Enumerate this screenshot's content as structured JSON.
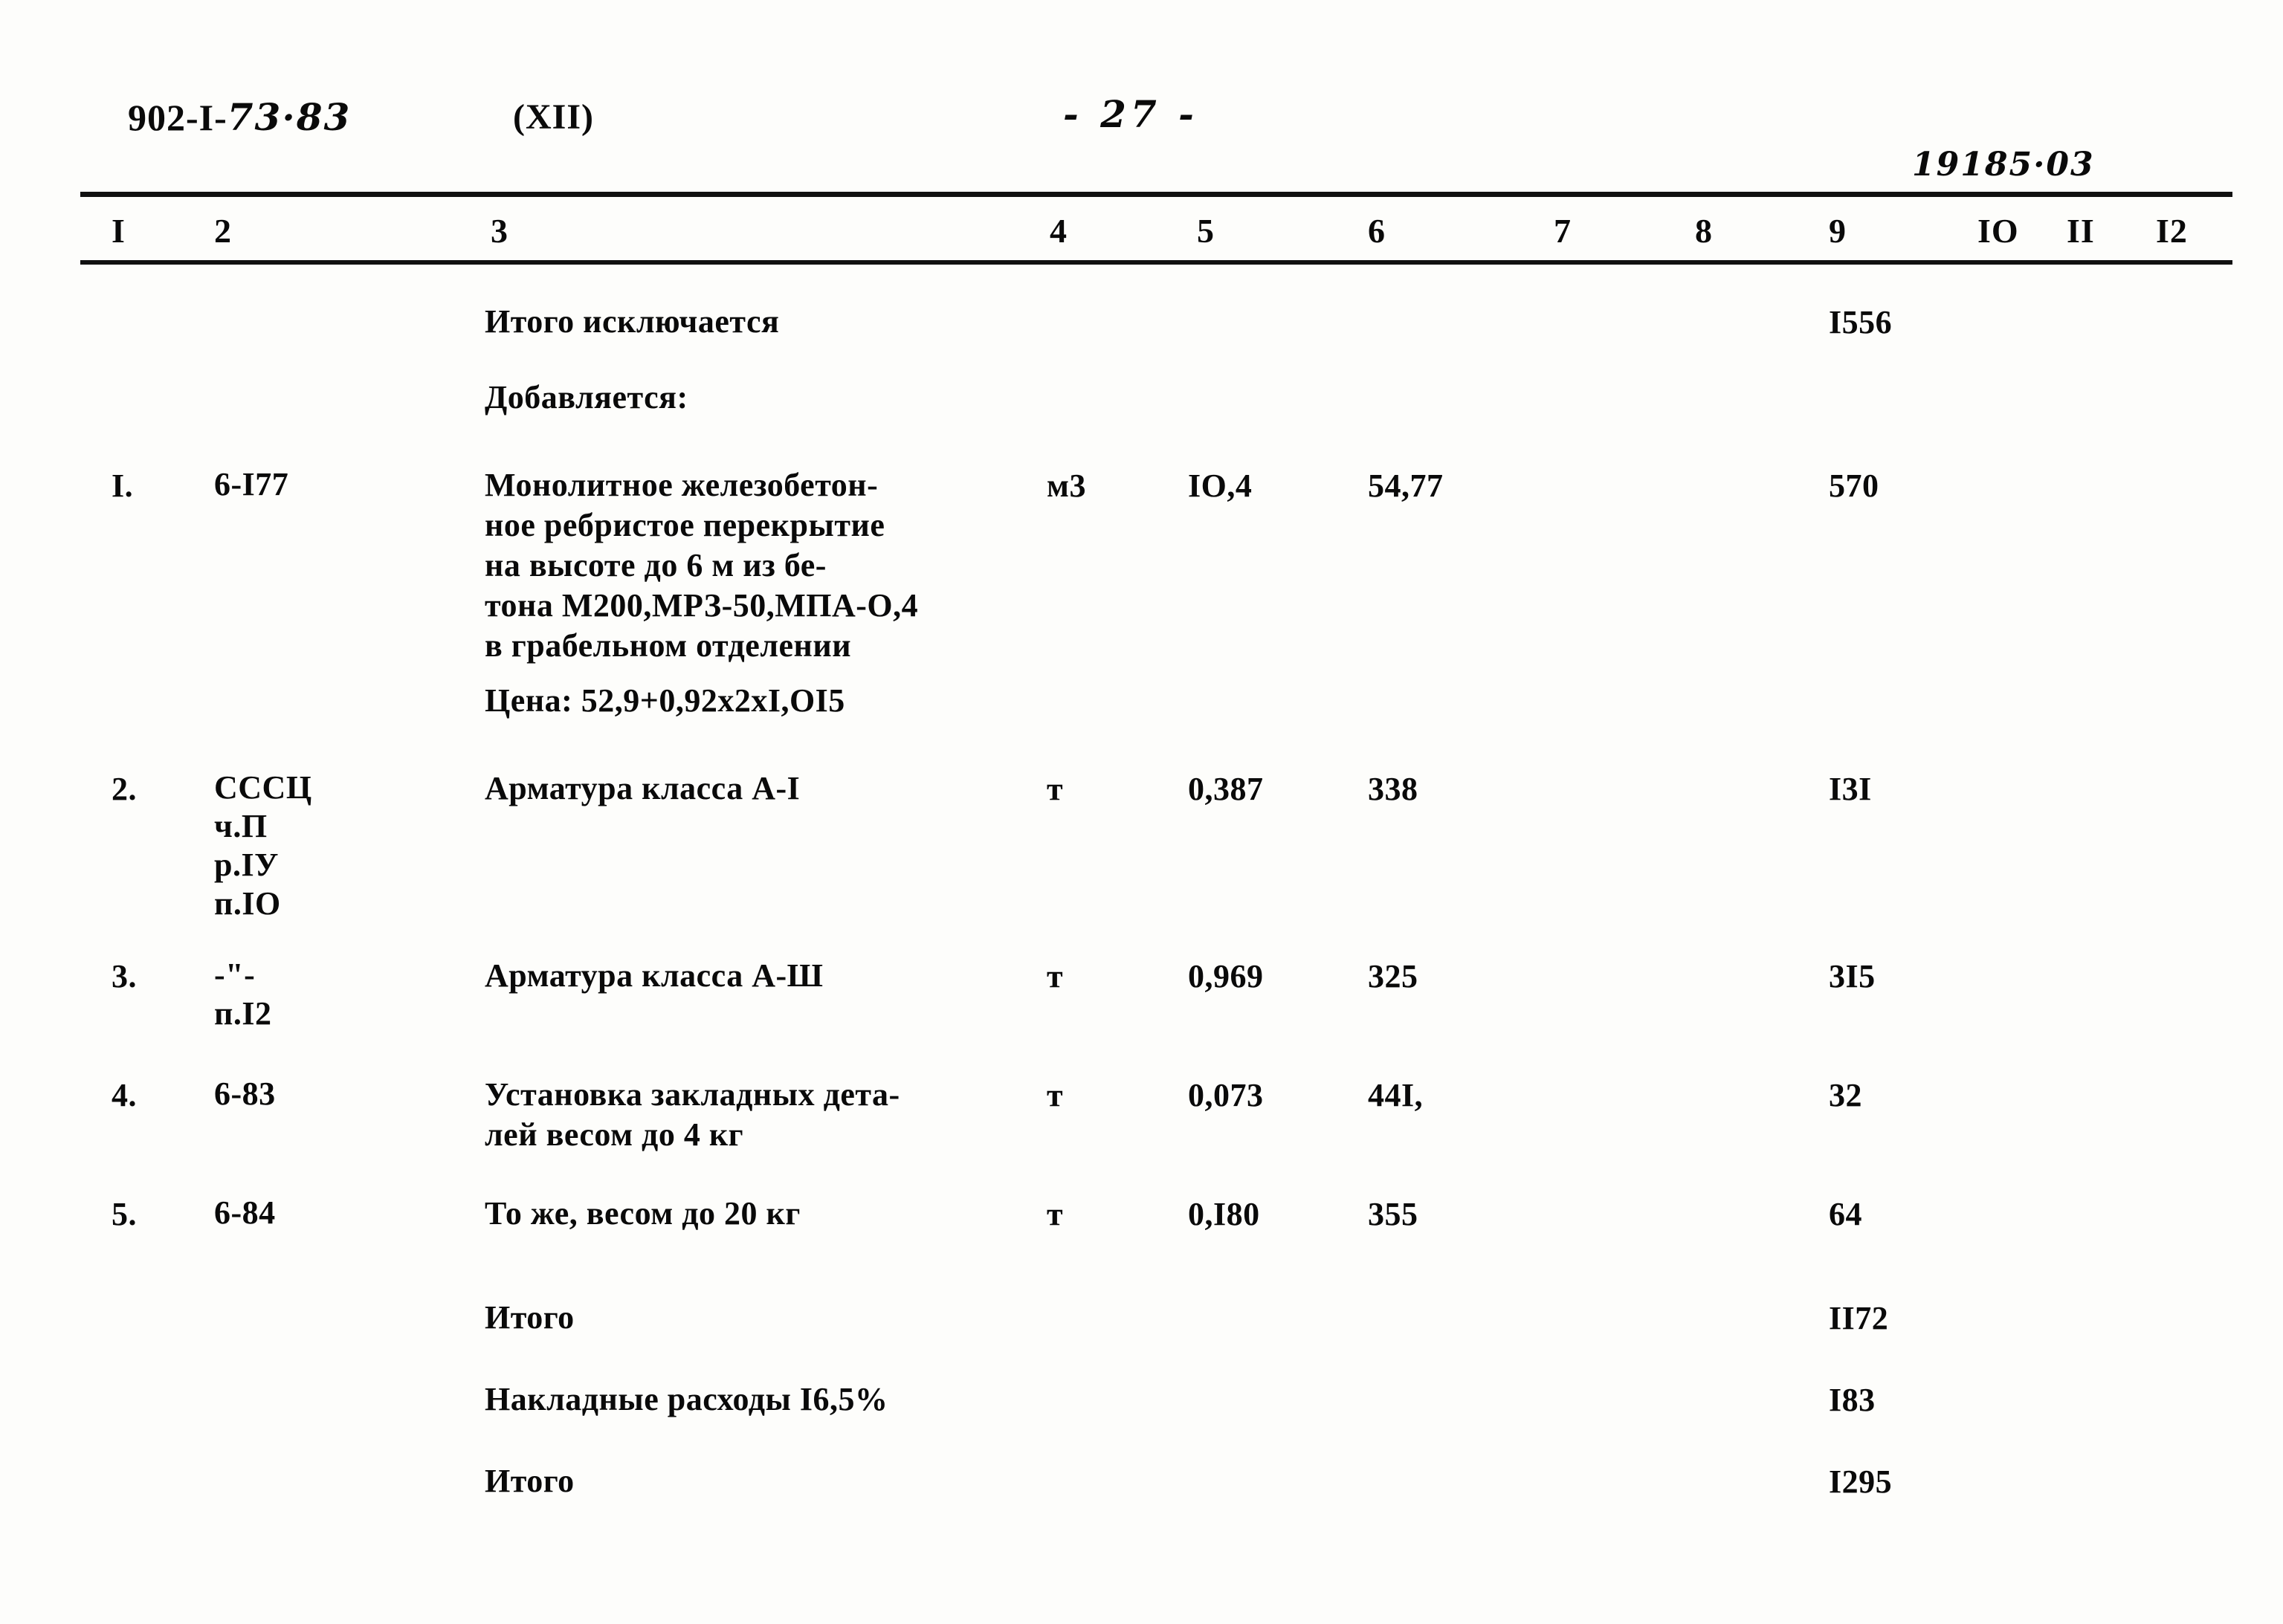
{
  "header": {
    "doc_code_prefix": "902-I-",
    "doc_code_hand": "73·83",
    "part": "(XII)",
    "page_number": "-  27  -",
    "stamp_number": "19185·03"
  },
  "table": {
    "column_headers": [
      "I",
      "2",
      "3",
      "4",
      "5",
      "6",
      "7",
      "8",
      "9",
      "IO",
      "II",
      "I2"
    ],
    "rows": [
      {
        "num": "",
        "code": "",
        "desc": "Итого исключается",
        "unit": "",
        "qty": "",
        "price": "",
        "total": "I556"
      },
      {
        "num": "",
        "code": "",
        "desc": "Добавляется:",
        "unit": "",
        "qty": "",
        "price": "",
        "total": ""
      },
      {
        "num": "I.",
        "code": "6-I77",
        "desc": "Монолитное железобетон-\nное ребристое перекрытие\nна высоте до 6 м из бе-\nтона М200,МРЗ-50,МПА-О,4\nв грабельном отделении",
        "unit": "м3",
        "qty": "IO,4",
        "price": "54,77",
        "total": "570"
      },
      {
        "num": "",
        "code": "",
        "desc": "Цена: 52,9+0,92х2хI,OI5",
        "unit": "",
        "qty": "",
        "price": "",
        "total": ""
      },
      {
        "num": "2.",
        "code": "СССЦ\nч.П\nр.IУ\nп.IO",
        "desc": "Арматура класса А-I",
        "unit": "т",
        "qty": "0,387",
        "price": "338",
        "total": "I3I"
      },
      {
        "num": "3.",
        "code": "-\"-\nп.I2",
        "desc": "Арматура класса А-Ш",
        "unit": "т",
        "qty": "0,969",
        "price": "325",
        "total": "3I5"
      },
      {
        "num": "4.",
        "code": "6-83",
        "desc": "Установка закладных дета-\nлей весом до 4 кг",
        "unit": "т",
        "qty": "0,073",
        "price": "44I,",
        "total": "32"
      },
      {
        "num": "5.",
        "code": "6-84",
        "desc": "То же, весом до 20 кг",
        "unit": "т",
        "qty": "0,I80",
        "price": "355",
        "total": "64"
      },
      {
        "num": "",
        "code": "",
        "desc": "Итого",
        "unit": "",
        "qty": "",
        "price": "",
        "total": "II72"
      },
      {
        "num": "",
        "code": "",
        "desc": "Накладные расходы I6,5%",
        "unit": "",
        "qty": "",
        "price": "",
        "total": "I83"
      },
      {
        "num": "",
        "code": "",
        "desc": "Итого",
        "unit": "",
        "qty": "",
        "price": "",
        "total": "I295"
      }
    ]
  }
}
